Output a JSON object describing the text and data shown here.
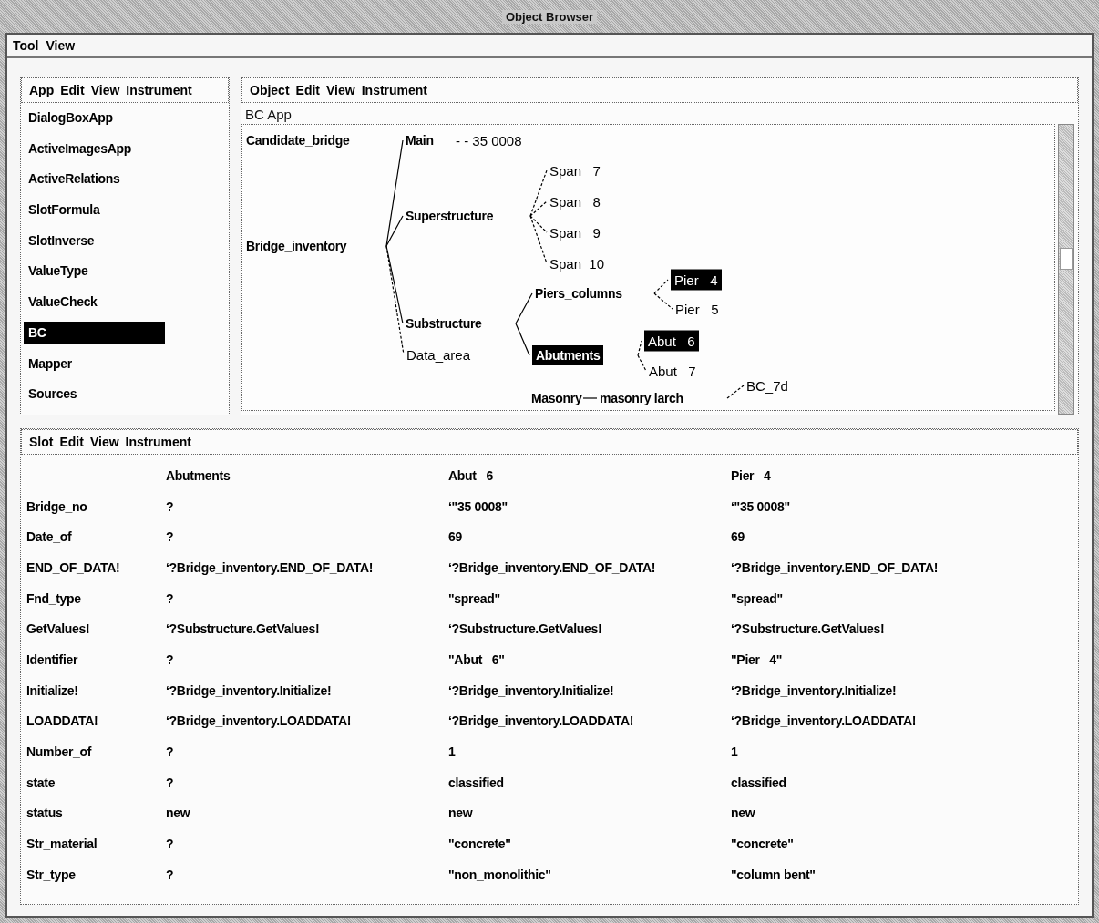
{
  "window": {
    "title": "Object Browser"
  },
  "menubar": [
    "Tool",
    "View"
  ],
  "app_panel": {
    "menus": [
      "App",
      "Edit",
      "View",
      "Instrument"
    ],
    "items": [
      {
        "label": "DialogBoxApp",
        "selected": false
      },
      {
        "label": "ActiveImagesApp",
        "selected": false
      },
      {
        "label": "ActiveRelations",
        "selected": false
      },
      {
        "label": "SlotFormula",
        "selected": false
      },
      {
        "label": "SlotInverse",
        "selected": false
      },
      {
        "label": "ValueType",
        "selected": false
      },
      {
        "label": "ValueCheck",
        "selected": false
      },
      {
        "label": "BC",
        "selected": true
      },
      {
        "label": "Mapper",
        "selected": false
      },
      {
        "label": "Sources",
        "selected": false
      }
    ]
  },
  "object_panel": {
    "menus": [
      "Object",
      "Edit",
      "View",
      "Instrument"
    ],
    "app_label": "BC App",
    "tree": [
      {
        "label": "Candidate_bridge",
        "kind": "class",
        "selected": false
      },
      {
        "label": "Bridge_inventory",
        "kind": "class",
        "selected": false,
        "children": [
          {
            "label": "Main",
            "kind": "class",
            "selected": false,
            "value": "- - 35 0008"
          },
          {
            "label": "Superstructure",
            "kind": "class",
            "selected": false,
            "children": [
              {
                "label": "Span   7",
                "kind": "instance",
                "selected": false
              },
              {
                "label": "Span   8",
                "kind": "instance",
                "selected": false
              },
              {
                "label": "Span   9",
                "kind": "instance",
                "selected": false
              },
              {
                "label": "Span  10",
                "kind": "instance",
                "selected": false
              }
            ]
          },
          {
            "label": "Substructure",
            "kind": "class",
            "selected": false,
            "children": [
              {
                "label": "Piers_columns",
                "kind": "class",
                "selected": false,
                "children": [
                  {
                    "label": "Pier   4",
                    "kind": "instance",
                    "selected": true
                  },
                  {
                    "label": "Pier   5",
                    "kind": "instance",
                    "selected": false
                  }
                ]
              },
              {
                "label": "Abutments",
                "kind": "class",
                "selected": true,
                "children": [
                  {
                    "label": "Abut   6",
                    "kind": "instance",
                    "selected": true
                  },
                  {
                    "label": "Abut   7",
                    "kind": "instance",
                    "selected": false
                  }
                ]
              }
            ]
          },
          {
            "label": "Data_area",
            "kind": "instance",
            "selected": false
          }
        ]
      },
      {
        "label": "Masonry",
        "kind": "class",
        "selected": false,
        "children": [
          {
            "label": "masonry larch",
            "kind": "class",
            "selected": false,
            "children": [
              {
                "label": "BC_7d",
                "kind": "instance",
                "selected": false
              }
            ]
          }
        ]
      }
    ]
  },
  "slot_panel": {
    "menus": [
      "Slot",
      "Edit",
      "View",
      "Instrument"
    ],
    "columns": [
      "Abutments",
      "Abut   6",
      "Pier   4"
    ],
    "rows": [
      {
        "name": "Bridge_no",
        "values": [
          "?",
          "‘\"35 0008\"",
          "‘\"35 0008\""
        ]
      },
      {
        "name": "Date_of",
        "values": [
          "?",
          "69",
          "69"
        ]
      },
      {
        "name": "END_OF_DATA!",
        "values": [
          "‘?Bridge_inventory.END_OF_DATA!",
          "‘?Bridge_inventory.END_OF_DATA!",
          "‘?Bridge_inventory.END_OF_DATA!"
        ]
      },
      {
        "name": "Fnd_type",
        "values": [
          "?",
          "\"spread\"",
          "\"spread\""
        ]
      },
      {
        "name": "GetValues!",
        "values": [
          "‘?Substructure.GetValues!",
          "‘?Substructure.GetValues!",
          "‘?Substructure.GetValues!"
        ]
      },
      {
        "name": "Identifier",
        "values": [
          "?",
          "\"Abut   6\"",
          "\"Pier   4\""
        ]
      },
      {
        "name": "Initialize!",
        "values": [
          "‘?Bridge_inventory.Initialize!",
          "‘?Bridge_inventory.Initialize!",
          "‘?Bridge_inventory.Initialize!"
        ]
      },
      {
        "name": "LOADDATA!",
        "values": [
          "‘?Bridge_inventory.LOADDATA!",
          "‘?Bridge_inventory.LOADDATA!",
          "‘?Bridge_inventory.LOADDATA!"
        ]
      },
      {
        "name": "Number_of",
        "values": [
          "?",
          "1",
          "1"
        ]
      },
      {
        "name": "state",
        "values": [
          "?",
          "classified",
          "classified"
        ]
      },
      {
        "name": "status",
        "values": [
          "new",
          "new",
          "new"
        ]
      },
      {
        "name": "Str_material",
        "values": [
          "?",
          "\"concrete\"",
          "\"concrete\""
        ]
      },
      {
        "name": "Str_type",
        "values": [
          "?",
          "\"non_monolithic\"",
          "\"column bent\""
        ]
      }
    ]
  }
}
